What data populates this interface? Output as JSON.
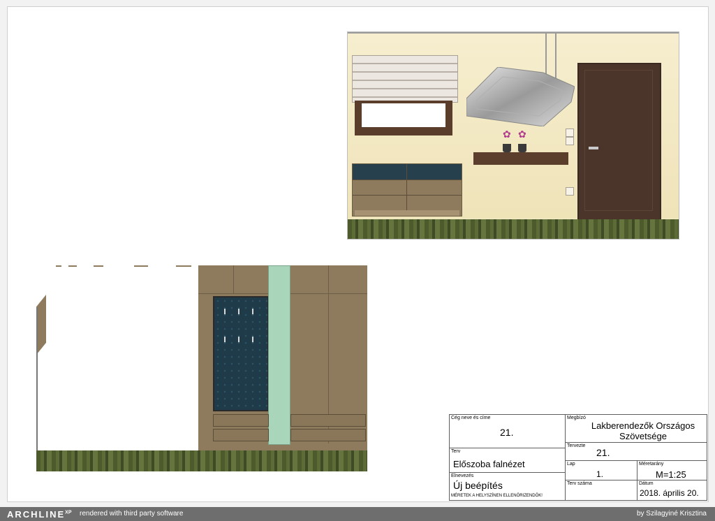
{
  "title_block": {
    "company_label": "Cég neve és címe",
    "company_value": "21.",
    "client_label": "Megbízó",
    "client_value": "Lakberendezők Országos Szövetsége",
    "designer_label": "Tervezte",
    "designer_value": "21.",
    "plan_label": "Terv",
    "plan_value": "Előszoba falnézet",
    "sheet_label": "Lap",
    "sheet_value": "1.",
    "scale_label": "Méretarány",
    "scale_value": "M=1:25",
    "name_label": "Elnevezés",
    "name_value": "Új beépítés",
    "plan_number_label": "Terv száma",
    "date_label": "Dátum",
    "date_value": "2018. április 20.",
    "note": "MÉRETEK A HELYSZÍNEN ELLENŐRIZENDŐK!"
  },
  "footer": {
    "logo": "ARCHLINE",
    "logo_suffix": "XP",
    "rendered_text": "rendered with third party software",
    "author": "by Szilagyiné Krisztina"
  },
  "colors": {
    "wall": "#f3ebc8",
    "wood_dark": "#4b352a",
    "wood_light": "#8e7a5d",
    "upholstery": "#1f3a48",
    "glass": "#a9d5bb",
    "floor": "#4d5a2c",
    "footer_bar": "#6e6e6e"
  }
}
